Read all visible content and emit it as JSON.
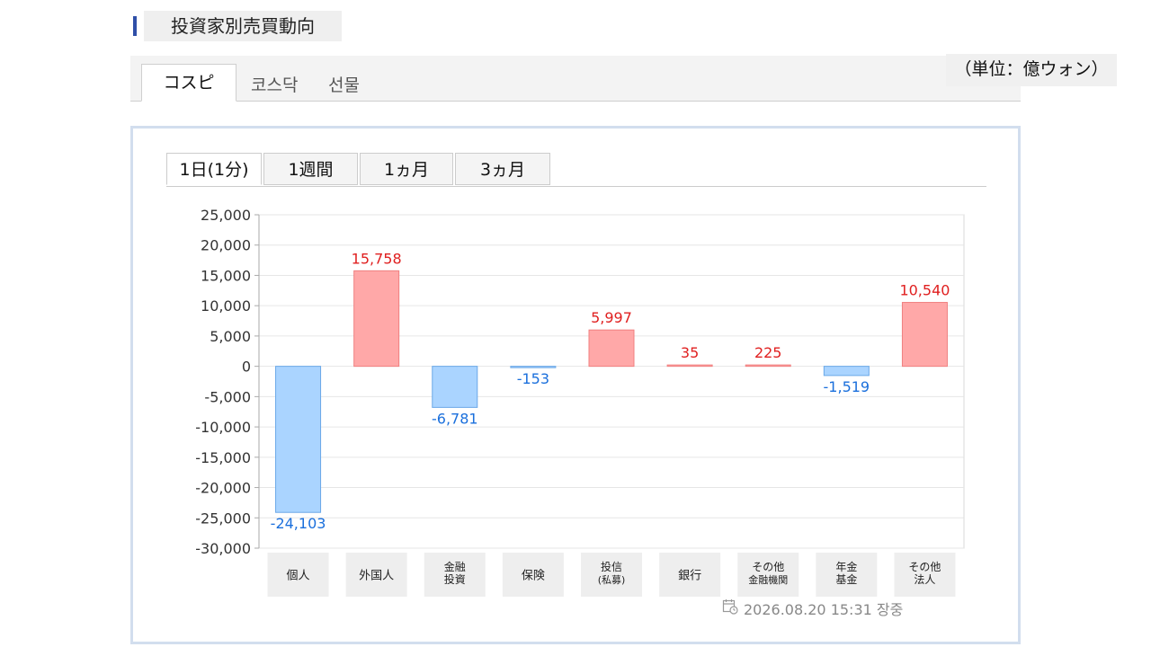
{
  "header": {
    "title": "投資家別売買動向"
  },
  "market_tabs": [
    {
      "label": "コスピ",
      "active": true
    },
    {
      "label": "코스닥",
      "active": false
    },
    {
      "label": "선물",
      "active": false
    }
  ],
  "unit_label": "（単位：億ウォン）",
  "period_tabs": [
    {
      "label": "1日(1分)",
      "active": true
    },
    {
      "label": "1週間",
      "active": false
    },
    {
      "label": "1ヵ月",
      "active": false
    },
    {
      "label": "3ヵ月",
      "active": false
    }
  ],
  "chart_data": {
    "type": "bar",
    "categories": [
      [
        "個人"
      ],
      [
        "外国人"
      ],
      [
        "金融",
        "投資"
      ],
      [
        "保険"
      ],
      [
        "投信",
        "(私募)"
      ],
      [
        "銀行"
      ],
      [
        "その他",
        "金融機関"
      ],
      [
        "年金",
        "基金"
      ],
      [
        "その他",
        "法人"
      ]
    ],
    "values": [
      -24103,
      15758,
      -6781,
      -153,
      5997,
      35,
      225,
      -1519,
      10540
    ],
    "value_labels": [
      "-24,103",
      "15,758",
      "-6,781",
      "-153",
      "5,997",
      "35",
      "225",
      "-1,519",
      "10,540"
    ],
    "yticks": [
      25000,
      20000,
      15000,
      10000,
      5000,
      0,
      -5000,
      -10000,
      -15000,
      -20000,
      -25000,
      -30000
    ],
    "ytick_labels": [
      "25,000",
      "20,000",
      "15,000",
      "10,000",
      "5,000",
      "0",
      "-5,000",
      "-10,000",
      "-15,000",
      "-20,000",
      "-25,000",
      "-30,000"
    ],
    "ylim": [
      -30000,
      25000
    ],
    "grid": true,
    "colors": {
      "positive_fill": "#ffa8a8",
      "positive_stroke": "#f08080",
      "positive_text": "#e02020",
      "negative_fill": "#aad4ff",
      "negative_stroke": "#6aa8e8",
      "negative_text": "#1a6fdc"
    }
  },
  "timestamp": {
    "text": "2026.08.20 15:31 장중",
    "icon": "calendar-clock-icon"
  }
}
